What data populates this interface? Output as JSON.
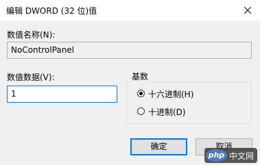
{
  "window": {
    "title": "编辑 DWORD (32 位)值",
    "close_icon": "close-icon"
  },
  "value_name": {
    "label": "数值名称(N):",
    "value": "NoControlPanel"
  },
  "value_data": {
    "label": "数值数据(V):",
    "value": "1"
  },
  "base": {
    "legend": "基数",
    "options": [
      {
        "label": "十六进制(H)",
        "selected": true
      },
      {
        "label": "十进制(D)",
        "selected": false
      }
    ]
  },
  "buttons": {
    "ok": "确定",
    "cancel": "取消"
  },
  "watermark": {
    "logo": "php",
    "text": "中文网"
  }
}
